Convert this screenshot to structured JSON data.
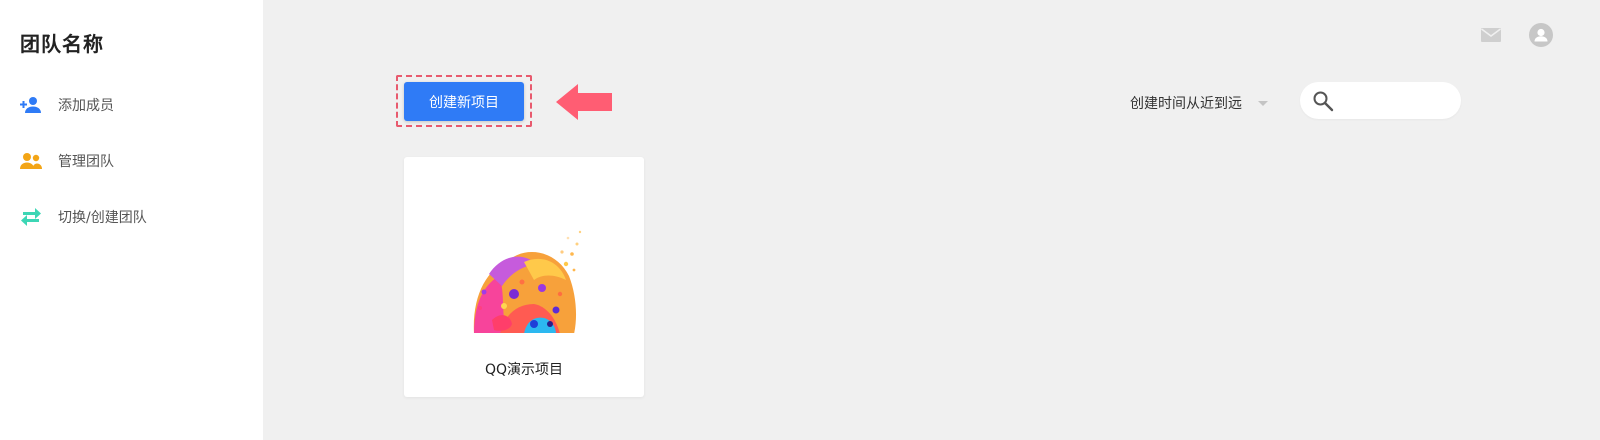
{
  "sidebar": {
    "team_name": "团队名称",
    "items": [
      {
        "label": "添加成员",
        "icon": "add-user-icon",
        "color": "#2f7bf6"
      },
      {
        "label": "管理团队",
        "icon": "team-icon",
        "color": "#f3a516"
      },
      {
        "label": "切换/创建团队",
        "icon": "swap-icon",
        "color": "#3dd6b5"
      }
    ]
  },
  "header": {
    "mail_icon": "mail-icon",
    "user_icon": "user-avatar-icon"
  },
  "toolbar": {
    "create_label": "创建新项目",
    "accent_color": "#2f7bf6",
    "highlight_color": "#e85a6e",
    "sort_label": "创建时间从近到远",
    "search_placeholder": "",
    "search_value": ""
  },
  "projects": [
    {
      "name": "QQ演示项目"
    }
  ]
}
